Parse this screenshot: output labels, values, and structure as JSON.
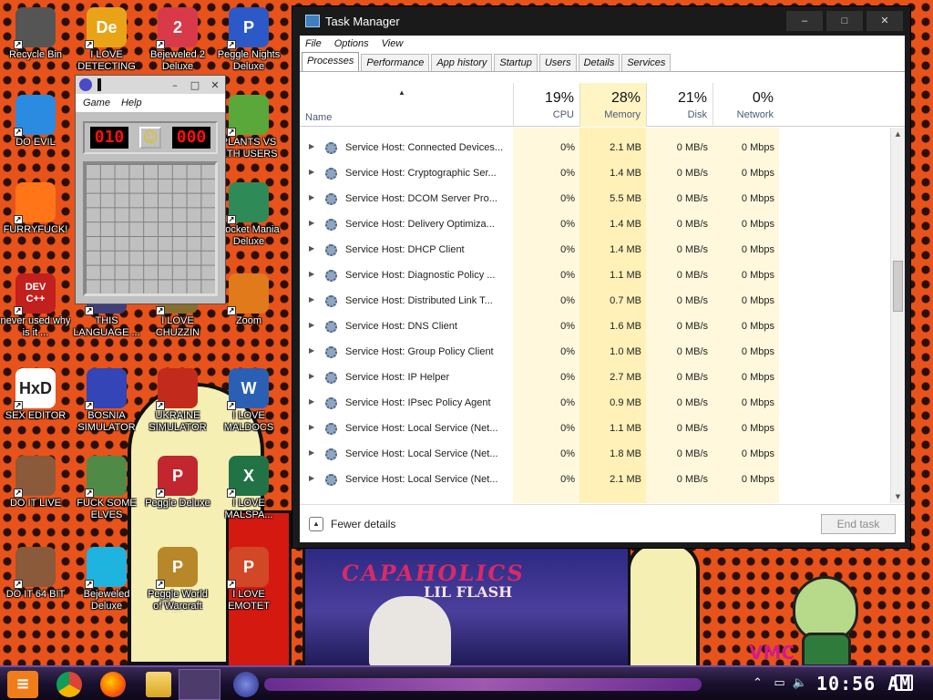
{
  "desktop": {
    "icons": [
      {
        "label": "Recycle Bin",
        "glyph": "",
        "color": "#555555",
        "icon": "recycle-bin-icon"
      },
      {
        "label": "I LOVE DETECTING",
        "glyph": "De",
        "color": "#e8a317",
        "icon": "de-app-icon"
      },
      {
        "label": "Bejeweled 2 Deluxe",
        "glyph": "2",
        "color": "#d83a4a",
        "icon": "bejeweled-icon"
      },
      {
        "label": "Peggle Nights Deluxe",
        "glyph": "P",
        "color": "#2c59c7",
        "icon": "peggle-icon"
      },
      {
        "label": "DO EVIL",
        "glyph": "",
        "color": "#2b8be0",
        "icon": "chrome-icon"
      },
      {
        "label": "FURRYFUCK!",
        "glyph": "",
        "color": "#ff7518",
        "icon": "firefox-icon"
      },
      {
        "label": "PLANTS VS ETH USERS",
        "glyph": "",
        "color": "#5aa83a",
        "icon": "plants-icon"
      },
      {
        "label": "Rocket Mania Deluxe",
        "glyph": "",
        "color": "#2e8b57",
        "icon": "rocket-icon"
      },
      {
        "label": "never used why is it ...",
        "glyph": "DEV C++",
        "color": "#c21f1f",
        "icon": "devcpp-icon"
      },
      {
        "label": "THIS LANGUAGE ...",
        "glyph": "",
        "color": "#3f3f7a",
        "icon": "language-icon"
      },
      {
        "label": "I LOVE CHUZZIN",
        "glyph": "",
        "color": "#8a6e2f",
        "icon": "chuzzle-icon"
      },
      {
        "label": "Zoom",
        "glyph": "",
        "color": "#e07a1a",
        "icon": "zoom-icon"
      },
      {
        "label": "SEX EDITOR",
        "glyph": "HxD",
        "color": "#ffffff",
        "icon": "hxd-icon"
      },
      {
        "label": "BOSNIA SIMULATOR",
        "glyph": "",
        "color": "#3345b7",
        "icon": "mine-icon"
      },
      {
        "label": "UKRAINE SIMULATOR",
        "glyph": "",
        "color": "#c22b1b",
        "icon": "radiation-icon"
      },
      {
        "label": "I LOVE MALDOCS",
        "glyph": "W",
        "color": "#2b5fb4",
        "icon": "word-icon"
      },
      {
        "label": "DO IT LIVE",
        "glyph": "",
        "color": "#8a5a3a",
        "icon": "portrait-icon"
      },
      {
        "label": "FUCK SOME ELVES",
        "glyph": "",
        "color": "#4f8a46",
        "icon": "santa-icon"
      },
      {
        "label": "Peggle Deluxe",
        "glyph": "P",
        "color": "#c2262e",
        "icon": "peggle-deluxe-icon"
      },
      {
        "label": "I LOVE MALSPA...",
        "glyph": "X",
        "color": "#217346",
        "icon": "excel-icon"
      },
      {
        "label": "DO IT 64 BIT",
        "glyph": "",
        "color": "#8a5a3a",
        "icon": "portrait-64-icon"
      },
      {
        "label": "Bejeweled Deluxe",
        "glyph": "",
        "color": "#1fb3e0",
        "icon": "diamond-icon"
      },
      {
        "label": "Peggle World of Warcraft Edition",
        "glyph": "P",
        "color": "#b8872a",
        "icon": "peggle-wow-icon"
      },
      {
        "label": "I LOVE EMOTET",
        "glyph": "P",
        "color": "#d24726",
        "icon": "powerpoint-icon"
      }
    ]
  },
  "minesweeper": {
    "menu": [
      "Game",
      "Help"
    ],
    "mines_left": "010",
    "timer": "000",
    "smiley": "☺"
  },
  "task_manager": {
    "title": "Task Manager",
    "menu": [
      "File",
      "Options",
      "View"
    ],
    "tabs": [
      "Processes",
      "Performance",
      "App history",
      "Startup",
      "Users",
      "Details",
      "Services"
    ],
    "active_tab": "Processes",
    "columns": {
      "name": "Name",
      "cpu": {
        "pct": "19%",
        "label": "CPU"
      },
      "memory": {
        "pct": "28%",
        "label": "Memory"
      },
      "disk": {
        "pct": "21%",
        "label": "Disk"
      },
      "network": {
        "pct": "0%",
        "label": "Network"
      }
    },
    "rows": [
      {
        "name": "Service Host: Connected Devices...",
        "cpu": "0%",
        "mem": "2.1 MB",
        "disk": "0 MB/s",
        "net": "0 Mbps"
      },
      {
        "name": "Service Host: Cryptographic Ser...",
        "cpu": "0%",
        "mem": "1.4 MB",
        "disk": "0 MB/s",
        "net": "0 Mbps"
      },
      {
        "name": "Service Host: DCOM Server Pro...",
        "cpu": "0%",
        "mem": "5.5 MB",
        "disk": "0 MB/s",
        "net": "0 Mbps"
      },
      {
        "name": "Service Host: Delivery Optimiza...",
        "cpu": "0%",
        "mem": "1.4 MB",
        "disk": "0 MB/s",
        "net": "0 Mbps"
      },
      {
        "name": "Service Host: DHCP Client",
        "cpu": "0%",
        "mem": "1.4 MB",
        "disk": "0 MB/s",
        "net": "0 Mbps"
      },
      {
        "name": "Service Host: Diagnostic Policy ...",
        "cpu": "0%",
        "mem": "1.1 MB",
        "disk": "0 MB/s",
        "net": "0 Mbps"
      },
      {
        "name": "Service Host: Distributed Link T...",
        "cpu": "0%",
        "mem": "0.7 MB",
        "disk": "0 MB/s",
        "net": "0 Mbps"
      },
      {
        "name": "Service Host: DNS Client",
        "cpu": "0%",
        "mem": "1.6 MB",
        "disk": "0 MB/s",
        "net": "0 Mbps"
      },
      {
        "name": "Service Host: Group Policy Client",
        "cpu": "0%",
        "mem": "1.0 MB",
        "disk": "0 MB/s",
        "net": "0 Mbps"
      },
      {
        "name": "Service Host: IP Helper",
        "cpu": "0%",
        "mem": "2.7 MB",
        "disk": "0 MB/s",
        "net": "0 Mbps"
      },
      {
        "name": "Service Host: IPsec Policy Agent",
        "cpu": "0%",
        "mem": "0.9 MB",
        "disk": "0 MB/s",
        "net": "0 Mbps"
      },
      {
        "name": "Service Host: Local Service (Net...",
        "cpu": "0%",
        "mem": "1.1 MB",
        "disk": "0 MB/s",
        "net": "0 Mbps"
      },
      {
        "name": "Service Host: Local Service (Net...",
        "cpu": "0%",
        "mem": "1.8 MB",
        "disk": "0 MB/s",
        "net": "0 Mbps"
      },
      {
        "name": "Service Host: Local Service (Net...",
        "cpu": "0%",
        "mem": "2.1 MB",
        "disk": "0 MB/s",
        "net": "0 Mbps"
      }
    ],
    "footer": {
      "fewer_details": "Fewer details",
      "end_task": "End task"
    }
  },
  "wallpaper": {
    "poster_title": "CAPAHOLICS",
    "poster_sub": "LIL FLASH",
    "corner_text": "VMC"
  },
  "taskbar": {
    "clock": "10:56 AM",
    "apps": [
      "start-menu",
      "chrome",
      "firefox",
      "file-explorer",
      "task-manager",
      "minesweeper"
    ]
  }
}
